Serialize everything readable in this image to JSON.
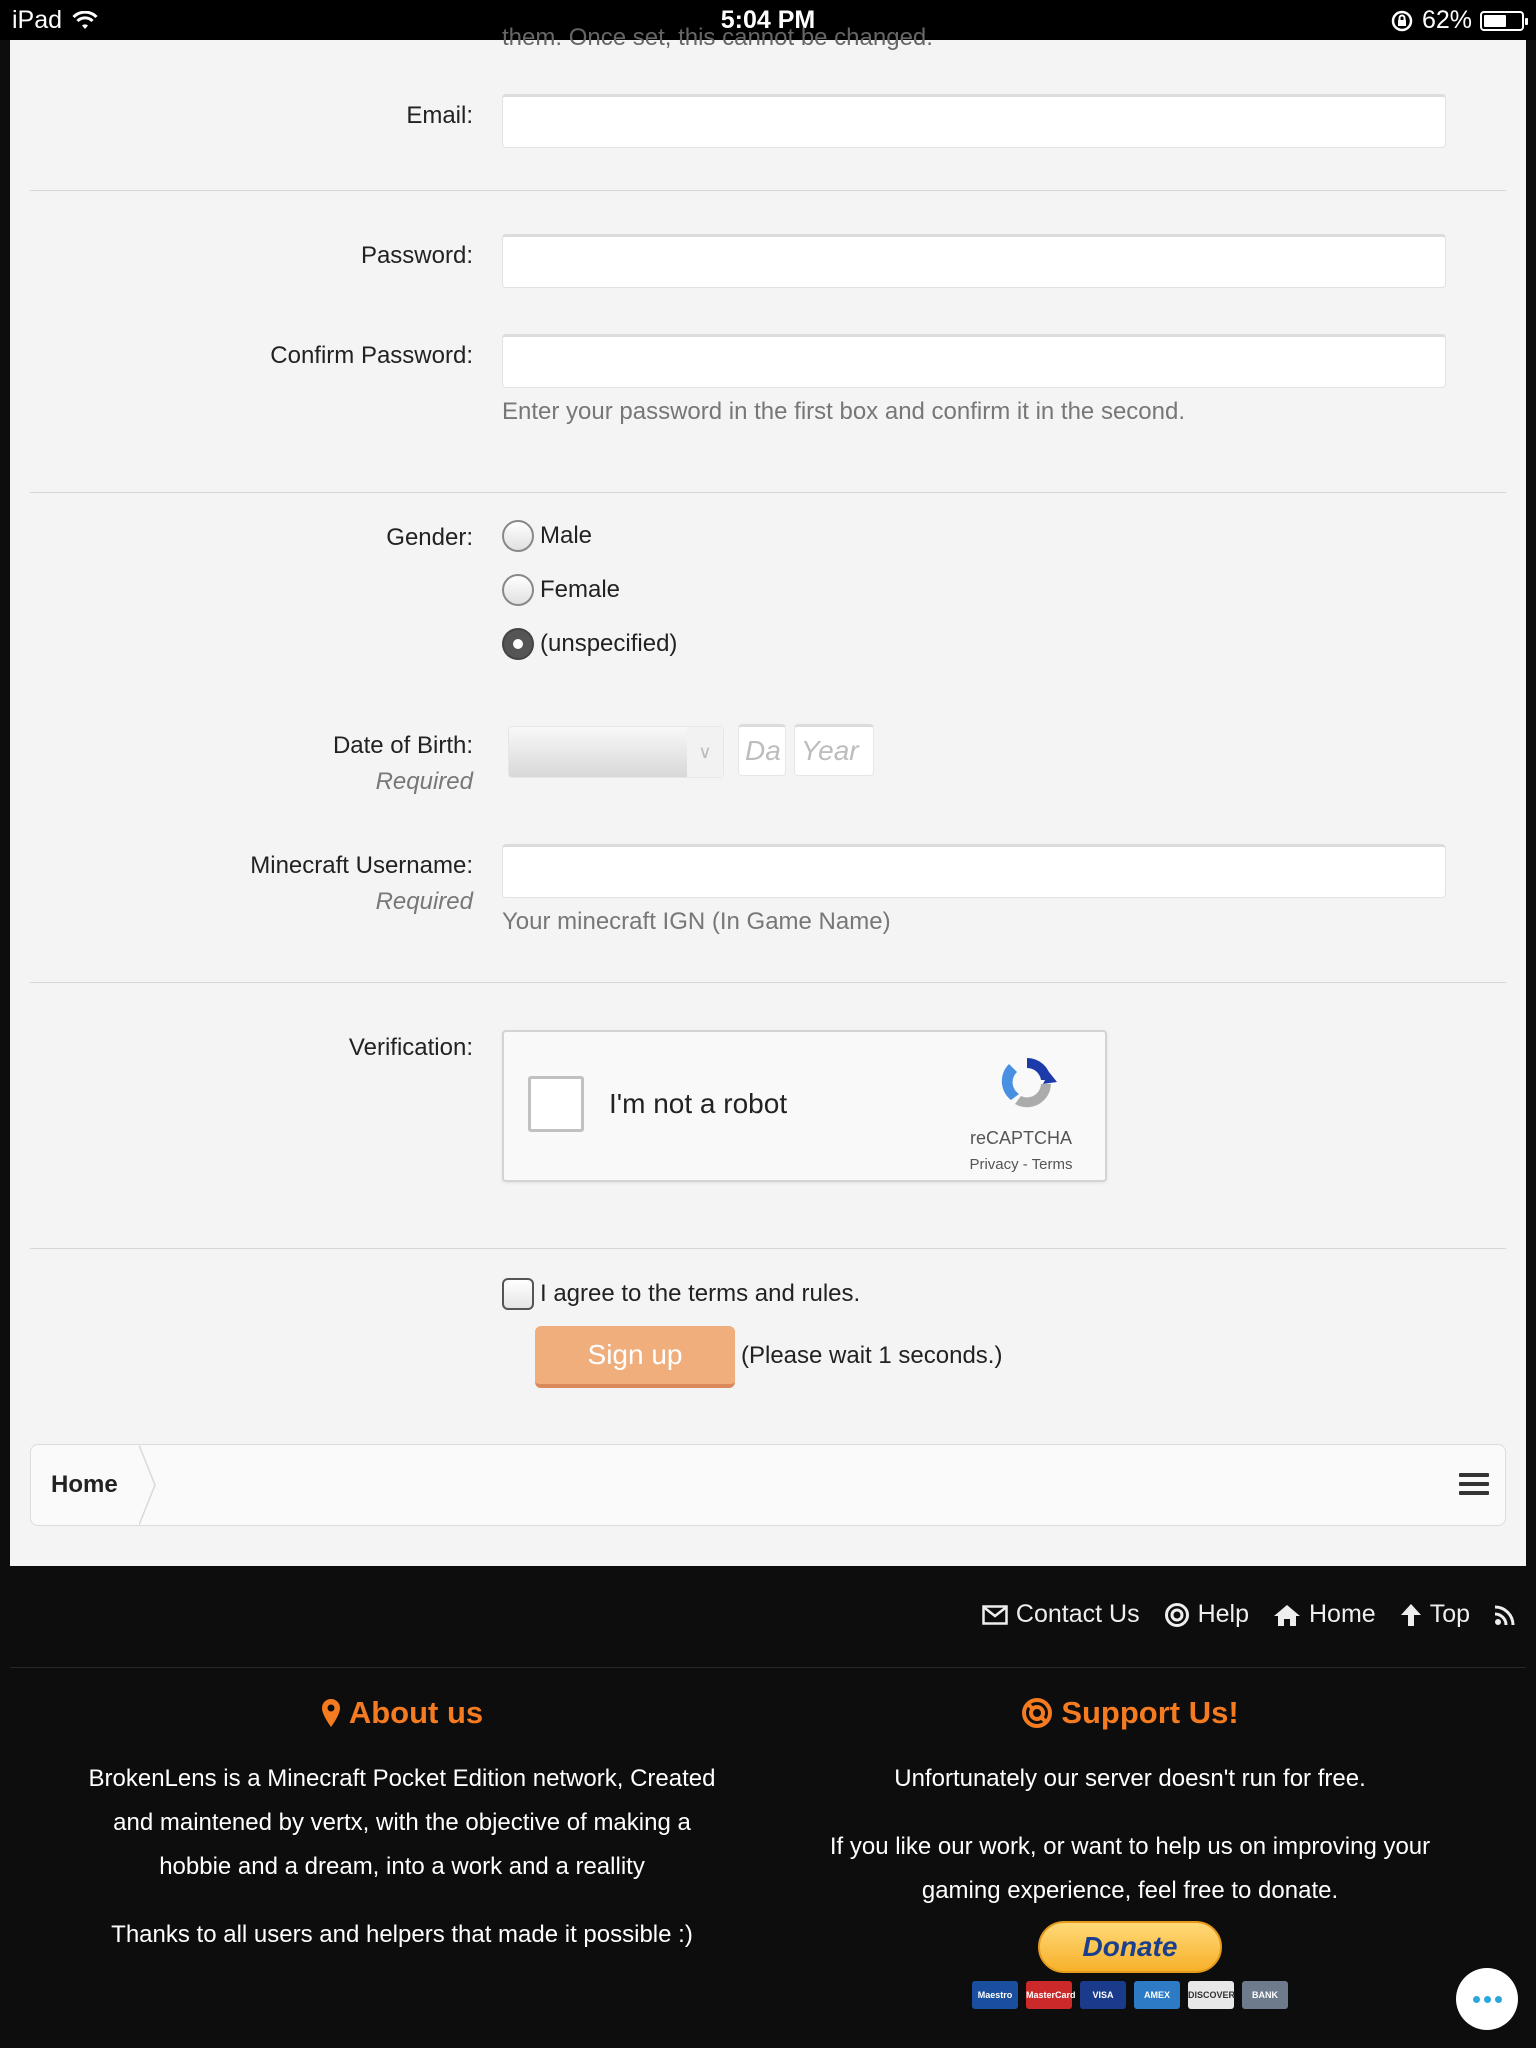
{
  "status_bar": {
    "device": "iPad",
    "time": "5:04 PM",
    "battery": "62%",
    "battery_level": 0.62
  },
  "form": {
    "cut_off_text": "them. Once set, this cannot be changed.",
    "email_label": "Email:",
    "password_label": "Password:",
    "confirm_password_label": "Confirm Password:",
    "password_hint": "Enter your password in the first box and confirm it in the second.",
    "gender_label": "Gender:",
    "gender_options": [
      "Male",
      "Female",
      "(unspecified)"
    ],
    "gender_selected": "(unspecified)",
    "dob_label": "Date of Birth:",
    "dob_required": "Required",
    "dob_day_placeholder": "Da",
    "dob_year_placeholder": "Year",
    "minecraft_label": "Minecraft Username:",
    "minecraft_required": "Required",
    "minecraft_hint": "Your minecraft IGN (In Game Name)",
    "verification_label": "Verification:",
    "captcha_text": "I'm not a robot",
    "captcha_brand": "reCAPTCHA",
    "captcha_links": "Privacy - Terms",
    "agree_prefix": "I agree to the ",
    "agree_link": "terms and rules",
    "agree_suffix": ".",
    "signup_label": "Sign up",
    "wait_text": "(Please wait 1 seconds.)"
  },
  "breadcrumb": {
    "home": "Home"
  },
  "footer": {
    "links": [
      "Contact Us",
      "Help",
      "Home",
      "Top"
    ],
    "about_title": "About us",
    "about_p1": "BrokenLens is a Minecraft Pocket Edition network, Created and maintened by vertx, with the objective of making a hobbie and a dream, into a work and a reallity",
    "about_p2": "Thanks to all users and helpers that made it possible :)",
    "support_title": "Support Us!",
    "support_p1": "Unfortunately our server doesn't run for free.",
    "support_p2": "If you like our work, or want to help us on improving your gaming experience, feel free to donate.",
    "donate_label": "Donate",
    "payment_cards": [
      "Maestro",
      "MasterCard",
      "VISA",
      "AMEX",
      "DISCOVER",
      "BANK"
    ]
  },
  "colors": {
    "accent": "#f57b21",
    "signup": "#f0ae7c",
    "footer_bg": "#0d0d0d",
    "page_bg": "#f4f4f4"
  }
}
